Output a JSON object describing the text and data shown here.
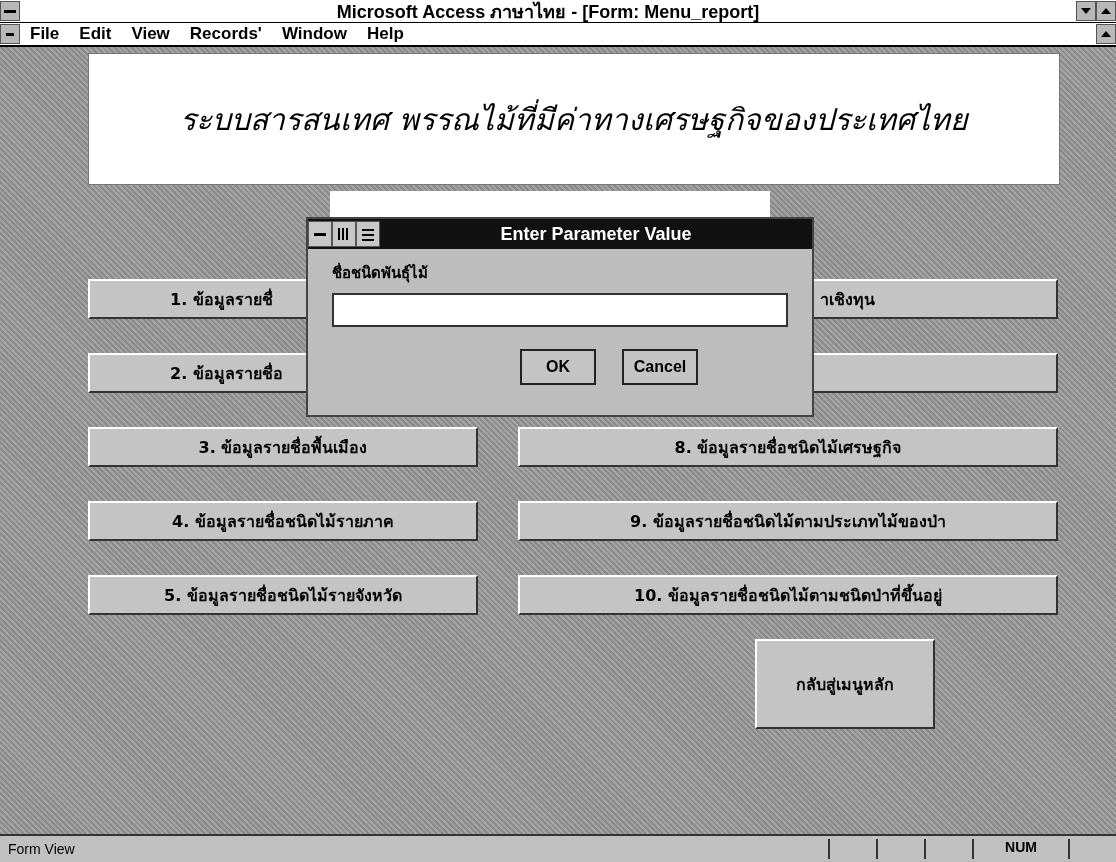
{
  "window": {
    "title": "Microsoft Access ภาษาไทย - [Form: Menu_report]"
  },
  "menu": [
    "File",
    "Edit",
    "View",
    "Records'",
    "Window",
    "Help"
  ],
  "header": {
    "title": "ระบบสารสนเทศ พรรณไม้ที่มีค่าทางเศรษฐกิจของประเทศไทย"
  },
  "left_buttons": [
    {
      "label": "1.  ข้อมูลรายชื่",
      "covered": true
    },
    {
      "label": "2.  ข้อมูลรายชื่อ",
      "covered": true
    },
    {
      "label": "3.  ข้อมูลรายชื่อพื้นเมือง",
      "covered": false
    },
    {
      "label": "4.  ข้อมูลรายชื่อชนิดไม้รายภาค",
      "covered": false
    },
    {
      "label": "5.  ข้อมูลรายชื่อชนิดไม้รายจังหวัด",
      "covered": false
    }
  ],
  "right_buttons": [
    {
      "label": "าเชิงทุน",
      "covered": true
    },
    {
      "label": "8.  ข้อมูลรายชื่อชนิดไม้เศรษฐกิจ",
      "covered": false
    },
    {
      "label": "9.  ข้อมูลรายชื่อชนิดไม้ตามประเภทไม้ของป่า",
      "covered": false
    },
    {
      "label": "10.  ข้อมูลรายชื่อชนิดไม้ตามชนิดป่าที่ขึ้นอยู่",
      "covered": false
    }
  ],
  "back_button": "กลับสู่เมนูหลัก",
  "dialog": {
    "title": "Enter Parameter Value",
    "label": "ชื่อชนิดพันธุ์ไม้",
    "buttons": [
      "OK",
      "Cancel"
    ]
  },
  "status_bar": {
    "text": "Form View",
    "indicators": [
      "NUM"
    ]
  }
}
